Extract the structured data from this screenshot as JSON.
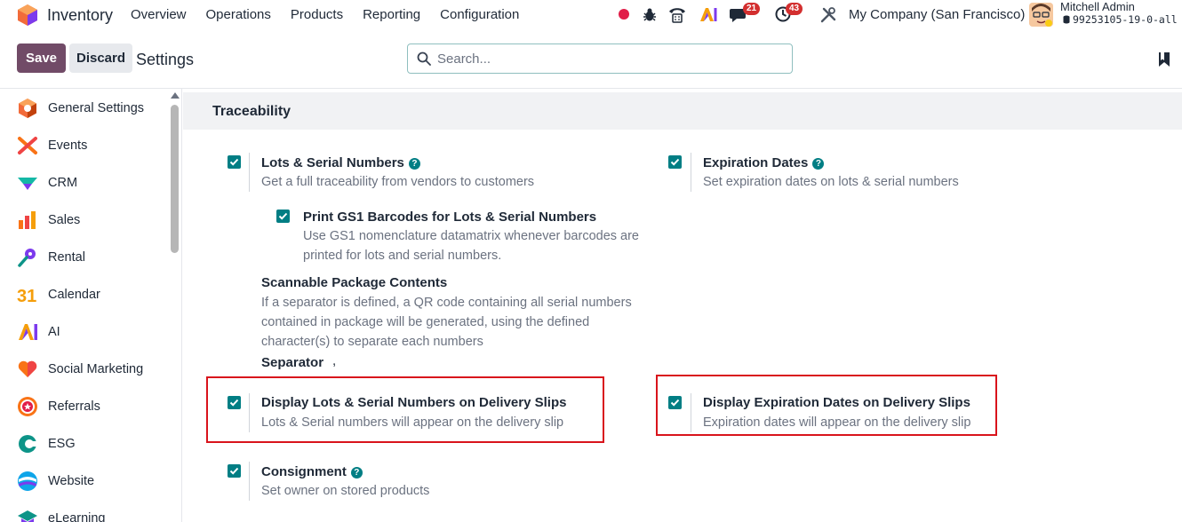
{
  "navbar": {
    "app_name": "Inventory",
    "menu": [
      "Overview",
      "Operations",
      "Products",
      "Reporting",
      "Configuration"
    ],
    "messages_badge": "21",
    "activity_badge": "43",
    "company": "My Company (San Francisco)",
    "user_name": "Mitchell Admin",
    "database": "99253105-19-0-all"
  },
  "control_panel": {
    "save_label": "Save",
    "discard_label": "Discard",
    "breadcrumb": "Settings",
    "search_placeholder": "Search..."
  },
  "sidebar": {
    "items": [
      {
        "label": "General Settings",
        "icon": "odoo-hexagon-icon"
      },
      {
        "label": "Events",
        "icon": "events-icon"
      },
      {
        "label": "CRM",
        "icon": "crm-icon"
      },
      {
        "label": "Sales",
        "icon": "sales-icon"
      },
      {
        "label": "Rental",
        "icon": "rental-icon"
      },
      {
        "label": "Calendar",
        "icon": "calendar-icon"
      },
      {
        "label": "AI",
        "icon": "ai-icon"
      },
      {
        "label": "Social Marketing",
        "icon": "social-marketing-icon"
      },
      {
        "label": "Referrals",
        "icon": "referrals-icon"
      },
      {
        "label": "ESG",
        "icon": "esg-icon"
      },
      {
        "label": "Website",
        "icon": "website-icon"
      },
      {
        "label": "eLearning",
        "icon": "elearning-icon"
      }
    ]
  },
  "calendar_icon_text": "31",
  "section": {
    "title": "Traceability",
    "lots": {
      "title": "Lots & Serial Numbers",
      "desc": "Get a full traceability from vendors to customers",
      "checked": true
    },
    "gs1": {
      "title": "Print GS1 Barcodes for Lots & Serial Numbers",
      "desc1": "Use GS1 nomenclature datamatrix whenever barcodes are",
      "desc2": "printed for lots and serial numbers.",
      "checked": true
    },
    "scannable": {
      "title": "Scannable Package Contents",
      "desc1": "If a separator is defined, a QR code containing all serial numbers",
      "desc2": "contained in package will be generated, using the defined",
      "desc3": "character(s) to separate each numbers",
      "separator_label": "Separator",
      "separator_value": ","
    },
    "expiration": {
      "title": "Expiration Dates",
      "desc": "Set expiration dates on lots & serial numbers",
      "checked": true
    },
    "display_lots": {
      "title": "Display Lots & Serial Numbers on Delivery Slips",
      "desc": "Lots & Serial numbers will appear on the delivery slip",
      "checked": true
    },
    "display_expiration": {
      "title": "Display Expiration Dates on Delivery Slips",
      "desc": "Expiration dates will appear on the delivery slip",
      "checked": true
    },
    "consignment": {
      "title": "Consignment",
      "desc": "Set owner on stored products",
      "checked": true
    }
  },
  "colors": {
    "primary": "#714b67",
    "checkbox": "#017e84",
    "highlight": "#d9141c",
    "badge": "#d32f2f"
  }
}
